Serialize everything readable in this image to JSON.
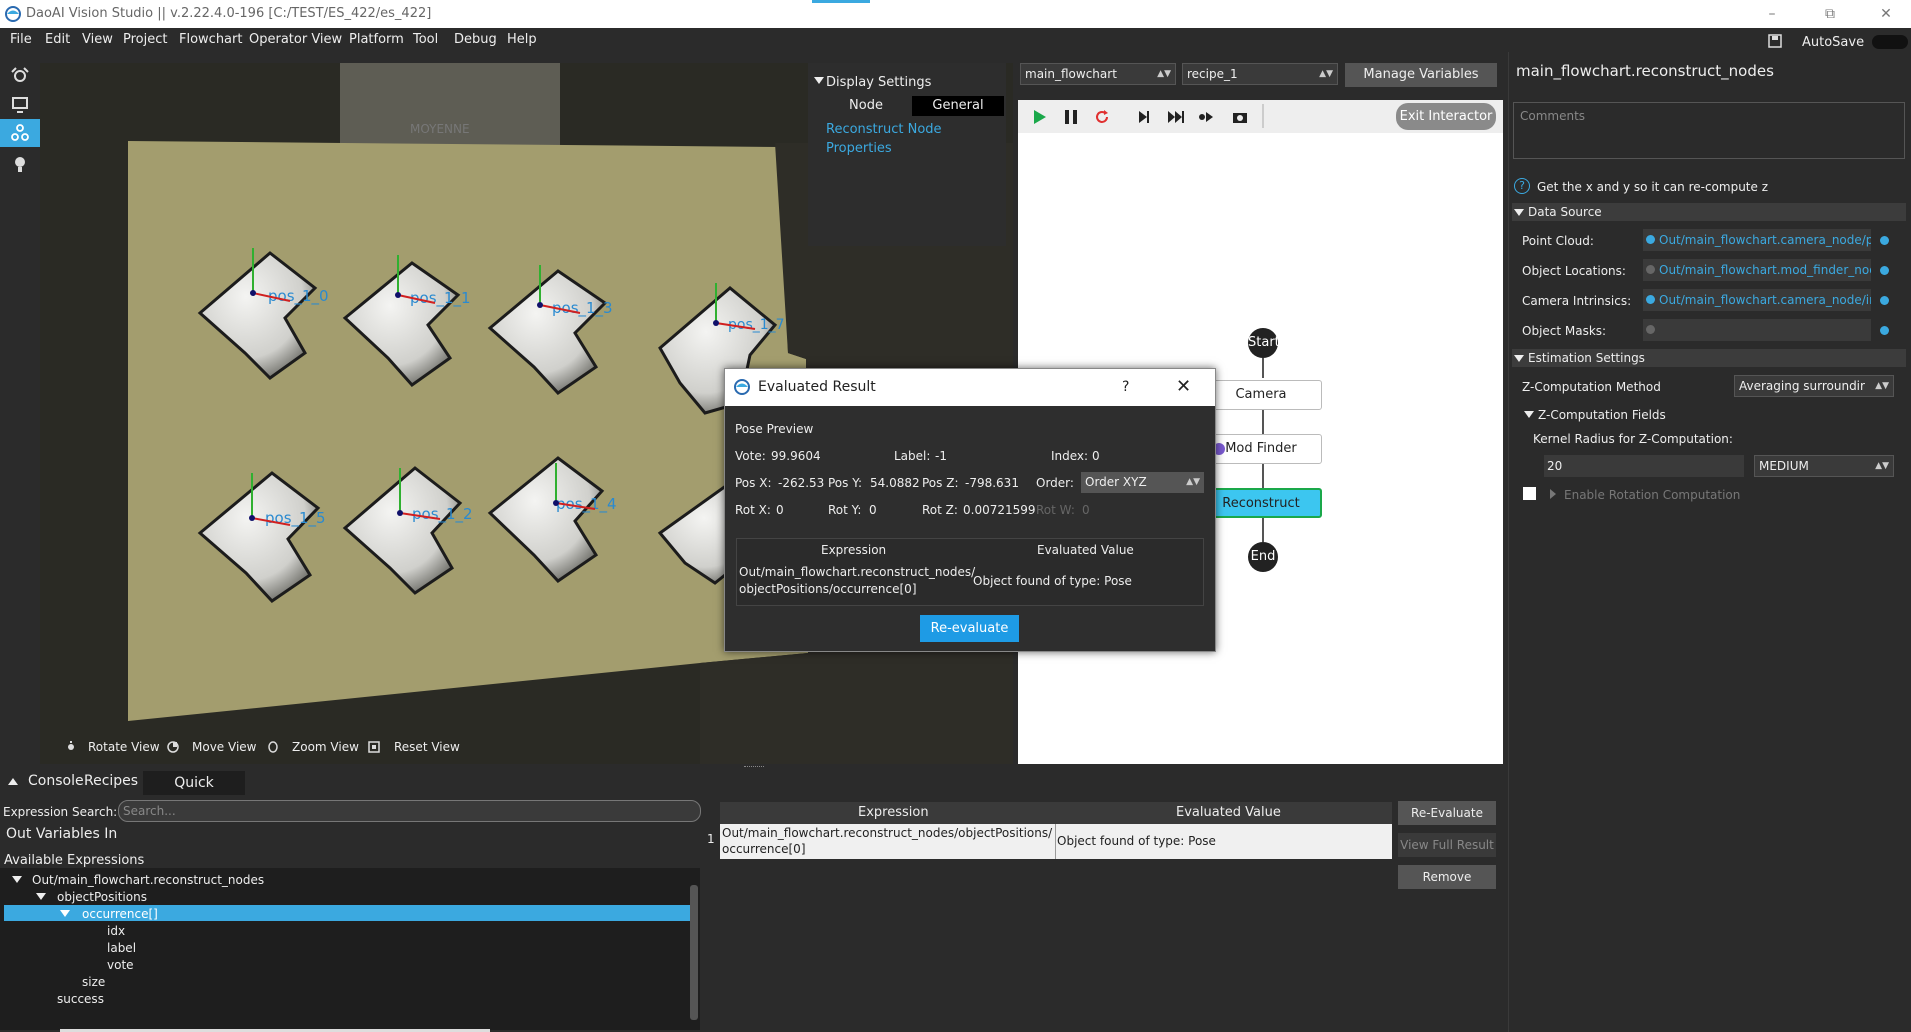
{
  "window": {
    "title": "DaoAI Vision Studio || v.2.22.4.0-196    [C:/TEST/ES_422/es_422]",
    "autosave_label": "AutoSave"
  },
  "menu": [
    "File",
    "Edit",
    "View",
    "Project",
    "Flowchart",
    "Operator View",
    "Platform",
    "Tool",
    "Debug",
    "Help"
  ],
  "viewer": {
    "toolbar": {
      "rotate": "Rotate View",
      "move": "Move View",
      "zoom": "Zoom View",
      "reset": "Reset View"
    },
    "labels": [
      "pos_1_0",
      "pos_1_1",
      "pos_1_3",
      "pos_1_7",
      "pos_1_5",
      "pos_1_2",
      "pos_1_4"
    ],
    "box_text": "MOYENNE"
  },
  "display_settings": {
    "title": "Display Settings",
    "tab_node": "Node",
    "tab_general": "General",
    "link1": "Reconstruct Node",
    "link2": "Properties"
  },
  "flowchart": {
    "flow_select": "main_flowchart",
    "recipe_select": "recipe_1",
    "manage_variables": "Manage Variables",
    "exit_interactor": "Exit Interactor",
    "nodes": {
      "start": "Start",
      "camera": "Camera",
      "mod_finder": "Mod Finder",
      "reconstruct": "Reconstruct",
      "end": "End"
    }
  },
  "right_panel": {
    "title": "main_flowchart.reconstruct_nodes",
    "comments_placeholder": "Comments",
    "description": "Get the x and y so it can re-compute z",
    "data_source": {
      "header": "Data Source",
      "point_cloud_label": "Point Cloud:",
      "point_cloud_value": "Out/main_flowchart.camera_node/po",
      "object_locations_label": "Object Locations:",
      "object_locations_value": "Out/main_flowchart.mod_finder_node",
      "camera_intrinsics_label": "Camera Intrinsics:",
      "camera_intrinsics_value": "Out/main_flowchart.camera_node/int",
      "object_masks_label": "Object Masks:",
      "object_masks_value": ""
    },
    "estimation": {
      "header": "Estimation Settings",
      "z_method_label": "Z-Computation Method",
      "z_method_value": "Averaging surroundir",
      "z_fields_label": "Z-Computation Fields",
      "kernel_label": "Kernel Radius for Z-Computation:",
      "kernel_value": "20",
      "kernel_size": "MEDIUM",
      "enable_rotation": "Enable Rotation Computation"
    }
  },
  "bottom": {
    "tabs": [
      "Console",
      "Recipes",
      "Quick Evaluate"
    ],
    "expression_search_label": "Expression Search:",
    "expression_search_placeholder": "Search...",
    "out_vars": "Out Variables In",
    "available": "Available Expressions",
    "tree": {
      "root": "Out/main_flowchart.reconstruct_nodes",
      "object_positions": "objectPositions",
      "occurrence": "occurrence[]",
      "idx": "idx",
      "label": "label",
      "vote": "vote",
      "size": "size",
      "success": "success"
    },
    "table": {
      "col_expression": "Expression",
      "col_value": "Evaluated Value",
      "row_num": "1",
      "row_expression_1": "Out/main_flowchart.reconstruct_nodes/objectPositions/",
      "row_expression_2": "occurrence[0]",
      "row_value": "Object found of type: Pose"
    },
    "buttons": {
      "reevaluate": "Re-Evaluate",
      "view_full": "View Full Result",
      "remove": "Remove"
    }
  },
  "dialog": {
    "title": "Evaluated Result",
    "help": "?",
    "pose_preview": "Pose Preview",
    "vote_label": "Vote:",
    "vote_value": "99.9604",
    "label_label": "Label:",
    "label_value": "-1",
    "index_label": "Index:",
    "index_value": "0",
    "posx_label": "Pos X:",
    "posx_value": "-262.53",
    "posy_label": "Pos Y:",
    "posy_value": "54.0882",
    "posz_label": "Pos Z:",
    "posz_value": "-798.631",
    "order_label": "Order:",
    "order_value": "Order XYZ",
    "rotx_label": "Rot X:",
    "rotx_value": "0",
    "roty_label": "Rot Y:",
    "roty_value": "0",
    "rotz_label": "Rot Z:",
    "rotz_value": "0.00721599",
    "rotw_label": "Rot W:",
    "rotw_value": "0",
    "col_expression": "Expression",
    "col_value": "Evaluated Value",
    "expr_line1": "Out/main_flowchart.reconstruct_nodes/",
    "expr_line2": "objectPositions/occurrence[0]",
    "value": "Object found of type: Pose",
    "reevaluate": "Re-evaluate"
  },
  "colors": {
    "accent": "#3ba9e0",
    "reconstruct_node": "#3cc6f0",
    "dialog_button": "#1e9be5"
  }
}
